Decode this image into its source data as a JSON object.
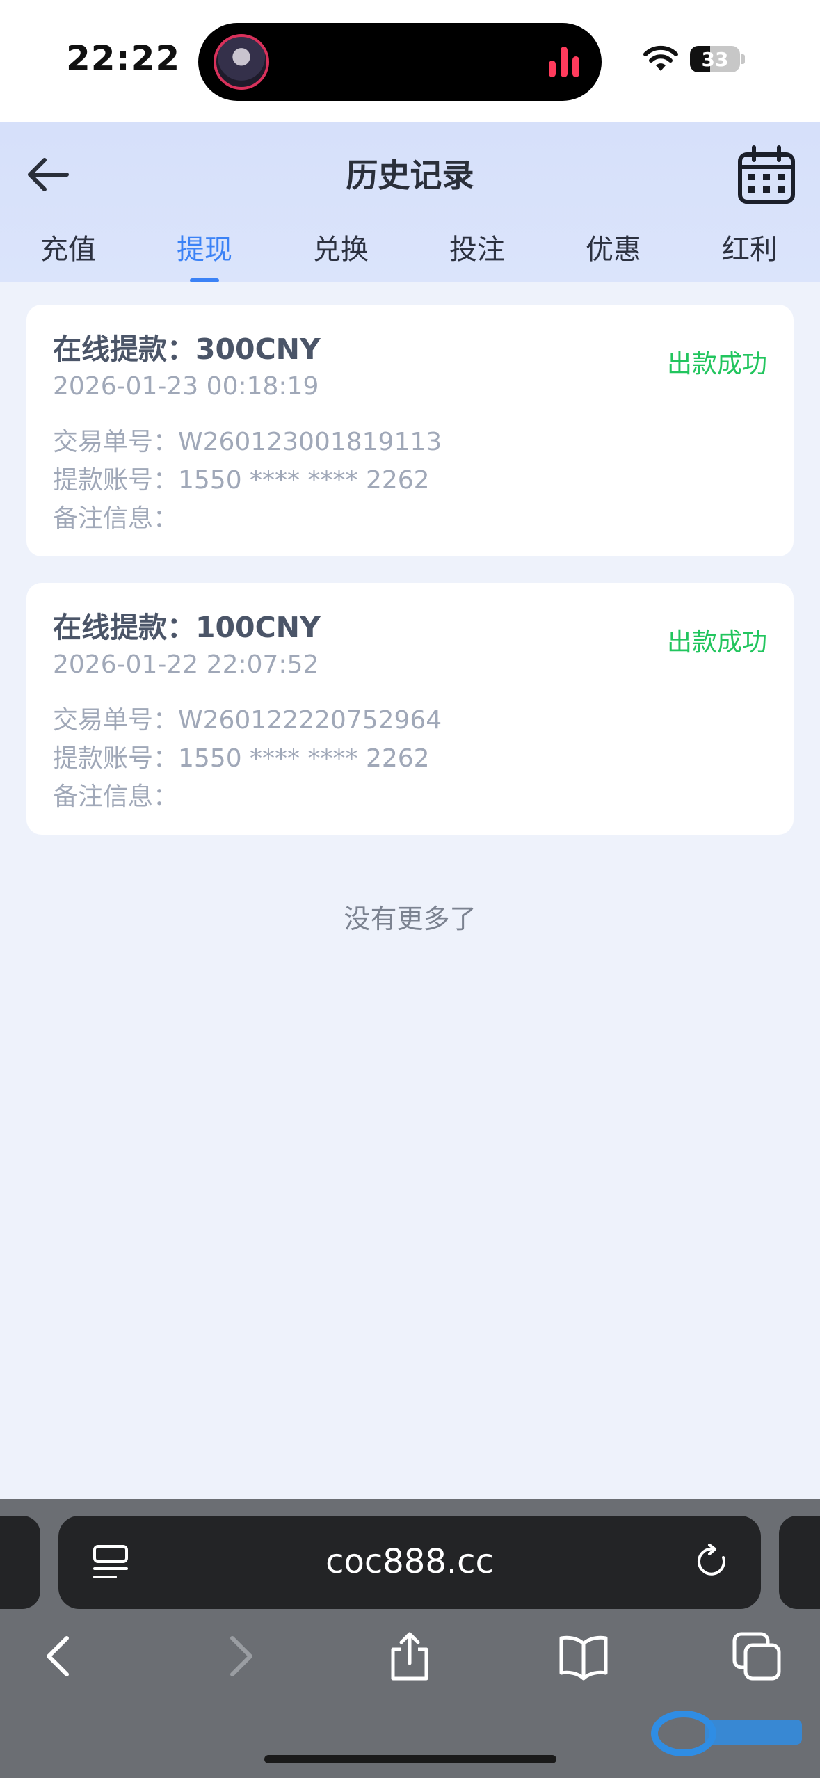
{
  "status_bar": {
    "time": "22:22",
    "battery": "33"
  },
  "header": {
    "title": "历史记录"
  },
  "tabs": [
    {
      "label": "充值",
      "active": false
    },
    {
      "label": "提现",
      "active": true
    },
    {
      "label": "兑换",
      "active": false
    },
    {
      "label": "投注",
      "active": false
    },
    {
      "label": "优惠",
      "active": false
    },
    {
      "label": "红利",
      "active": false
    }
  ],
  "records": [
    {
      "title": "在线提款：300CNY",
      "date": "2026-01-23 00:18:19",
      "status": "出款成功",
      "order": "交易单号：W260123001819113",
      "account": "提款账号：1550 **** **** 2262",
      "note": "备注信息："
    },
    {
      "title": "在线提款：100CNY",
      "date": "2026-01-22 22:07:52",
      "status": "出款成功",
      "order": "交易单号：W260122220752964",
      "account": "提款账号：1550 **** **** 2262",
      "note": "备注信息："
    }
  ],
  "footer_text": "没有更多了",
  "browser": {
    "url": "coc888.cc"
  },
  "colors": {
    "accent": "#3b82f6",
    "success": "#22c55e",
    "header_bg": "#d6e0fa",
    "page_bg": "#eef2fb"
  }
}
